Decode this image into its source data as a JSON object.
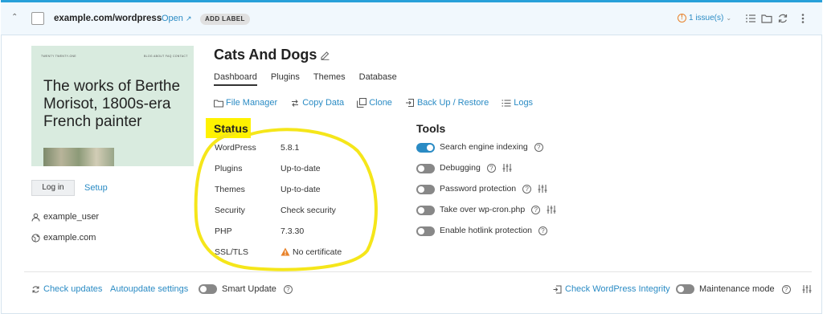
{
  "header": {
    "domain": "example.com/wordpress",
    "open_label": "Open",
    "add_label": "ADD LABEL",
    "issues_label": "1 issue(s)",
    "issues_icon": "!"
  },
  "preview": {
    "brand": "TWENTY TWENTY-ONE",
    "menu": "BLOG   ABOUT   FAQ   CONTACT",
    "headline": "The works of Berthe Morisot, 1800s-era French painter"
  },
  "sidebar": {
    "login_label": "Log in",
    "setup_label": "Setup",
    "user": "example_user",
    "site": "example.com"
  },
  "site": {
    "title": "Cats And Dogs"
  },
  "tabs": [
    {
      "label": "Dashboard",
      "active": true
    },
    {
      "label": "Plugins",
      "active": false
    },
    {
      "label": "Themes",
      "active": false
    },
    {
      "label": "Database",
      "active": false
    }
  ],
  "actions": [
    {
      "label": "File Manager",
      "icon": "folder-icon"
    },
    {
      "label": "Copy Data",
      "icon": "copy-data-icon"
    },
    {
      "label": "Clone",
      "icon": "clone-icon"
    },
    {
      "label": "Back Up / Restore",
      "icon": "backup-icon"
    },
    {
      "label": "Logs",
      "icon": "list-icon"
    }
  ],
  "status": {
    "title": "Status",
    "rows": [
      {
        "label": "WordPress",
        "value": "5.8.1"
      },
      {
        "label": "Plugins",
        "value": "Up-to-date"
      },
      {
        "label": "Themes",
        "value": "Up-to-date"
      },
      {
        "label": "Security",
        "value": "Check security"
      },
      {
        "label": "PHP",
        "value": "7.3.30"
      },
      {
        "label": "SSL/TLS",
        "value": "No certificate"
      }
    ]
  },
  "tools": {
    "title": "Tools",
    "items": [
      {
        "label": "Search engine indexing",
        "on": true,
        "settings": false
      },
      {
        "label": "Debugging",
        "on": false,
        "settings": true
      },
      {
        "label": "Password protection",
        "on": false,
        "settings": true
      },
      {
        "label": "Take over wp-cron.php",
        "on": false,
        "settings": true
      },
      {
        "label": "Enable hotlink protection",
        "on": false,
        "settings": false
      }
    ]
  },
  "footer": {
    "check_updates": "Check updates",
    "autoupdate_settings": "Autoupdate settings",
    "smart_update": "Smart Update",
    "check_integrity": "Check WordPress Integrity",
    "maintenance_mode": "Maintenance mode"
  },
  "help_glyph": "?",
  "colors": {
    "accent": "#2a8bc4",
    "header_bg": "#f1f8fd",
    "highlight": "#fff200",
    "annotation": "#f5e61a",
    "warning": "#e8822a"
  }
}
